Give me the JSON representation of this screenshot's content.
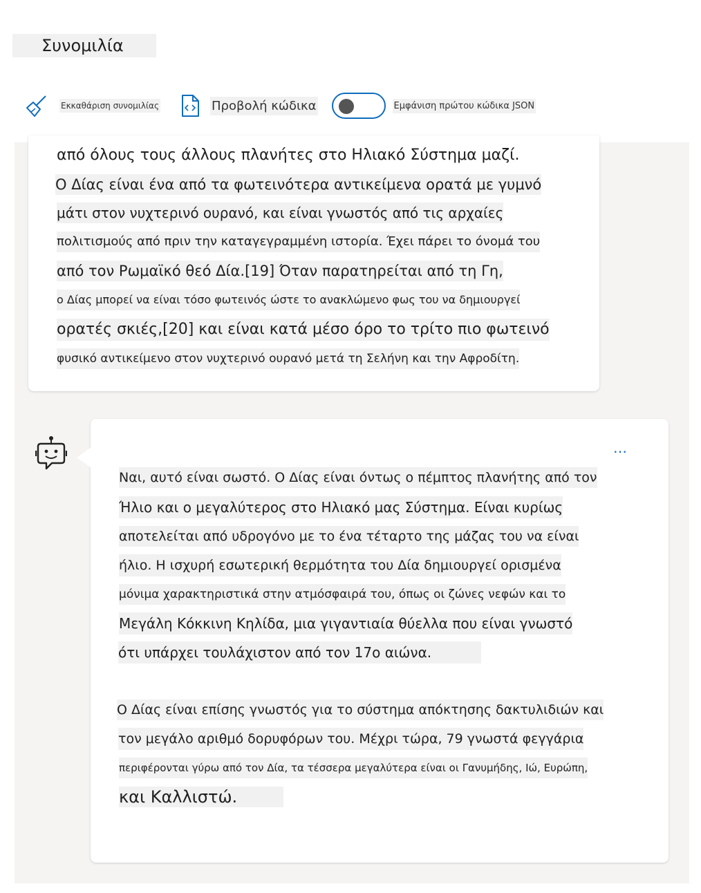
{
  "header": {
    "title": "Συνομιλία"
  },
  "toolbar": {
    "clear_label": "Εκκαθάριση συνομιλίας",
    "view_code_label": "Προβολή κώδικα",
    "toggle_label": "Εμφάνιση πρώτου κώδικα JSON",
    "toggle_on": false
  },
  "colors": {
    "accent": "#0f6cbd",
    "chat_bg": "#f5f4f3",
    "text_highlight": "#f1f1f1"
  },
  "user_message": {
    "lines": [
      "από όλους τους άλλους πλανήτες στο Ηλιακό Σύστημα μαζί.",
      "Ο Δίας είναι ένα από τα φωτεινότερα αντικείμενα ορατά με γυμνό",
      "μάτι στον νυχτερινό ουρανό, και είναι γνωστός από τις αρχαίες",
      "πολιτισμούς από πριν την καταγεγραμμένη ιστορία. Έχει πάρει το όνομά του",
      "από τον Ρωμαϊκό θεό Δία.[19] Όταν παρατηρείται από τη Γη,",
      "ο Δίας μπορεί να είναι τόσο φωτεινός ώστε το ανακλώμενο φως του να δημιουργεί",
      "ορατές σκιές,[20] και είναι κατά μέσο όρο το τρίτο πιο φωτεινό",
      "φυσικό αντικείμενο στον νυχτερινό ουρανό μετά τη Σελήνη και την Αφροδίτη."
    ]
  },
  "bot_message": {
    "more_label": "…",
    "paragraph1": [
      "Ναι, αυτό είναι σωστό. Ο Δίας είναι όντως ο πέμπτος πλανήτης από τον",
      "Ήλιο και ο μεγαλύτερος στο Ηλιακό μας Σύστημα. Είναι κυρίως",
      "αποτελείται από υδρογόνο με το ένα τέταρτο της μάζας του να είναι",
      "ήλιο. Η ισχυρή εσωτερική θερμότητα του Δία δημιουργεί ορισμένα",
      "μόνιμα χαρακτηριστικά στην ατμόσφαιρά του, όπως οι ζώνες νεφών και το",
      "Μεγάλη Κόκκινη Κηλίδα, μια γιγαντιαία θύελλα που είναι γνωστό",
      "ότι υπάρχει τουλάχιστον από τον 17ο αιώνα."
    ],
    "paragraph2": [
      "Ο Δίας είναι επίσης γνωστός για το σύστημα απόκτησης δακτυλιδιών και",
      "τον μεγάλο αριθμό δορυφόρων του. Μέχρι τώρα, 79 γνωστά φεγγάρια",
      "περιφέρονται γύρω από τον Δία, τα τέσσερα μεγαλύτερα είναι οι Γανυμήδης, Ιώ, Ευρώπη,",
      "και Καλλιστώ."
    ]
  }
}
